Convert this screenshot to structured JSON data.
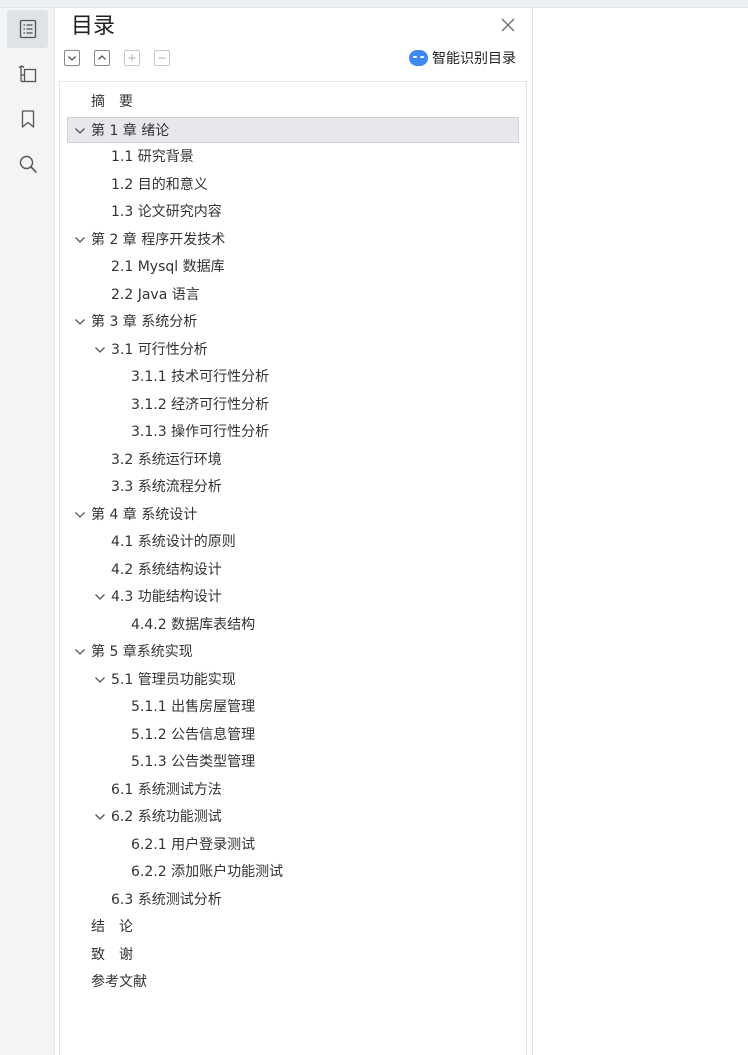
{
  "panel": {
    "title": "目录",
    "smart_label": "智能识别目录"
  },
  "icons": {
    "rail": [
      "toc-icon",
      "outline-tree-icon",
      "bookmark-icon",
      "search-icon"
    ],
    "toolbar": [
      "collapse-all-icon",
      "expand-all-icon",
      "add-icon",
      "remove-icon"
    ]
  },
  "colors": {
    "accent": "#3d8bf0",
    "selected_row": "#e6e8ec"
  },
  "toc": [
    {
      "text": "摘　要",
      "level": 0,
      "chevron": false
    },
    {
      "text": "第 1 章  绪论",
      "level": 0,
      "chevron": true,
      "selected": true
    },
    {
      "text": "1.1  研究背景",
      "level": 1,
      "chevron": false
    },
    {
      "text": "1.2 目的和意义",
      "level": 1,
      "chevron": false
    },
    {
      "text": "1.3  论文研究内容",
      "level": 1,
      "chevron": false
    },
    {
      "text": "第 2 章  程序开发技术",
      "level": 0,
      "chevron": true
    },
    {
      "text": "2.1 Mysql 数据库",
      "level": 1,
      "chevron": false
    },
    {
      "text": "2.2 Java 语言",
      "level": 1,
      "chevron": false
    },
    {
      "text": "第 3 章  系统分析",
      "level": 0,
      "chevron": true
    },
    {
      "text": "3.1 可行性分析",
      "level": 1,
      "chevron": true
    },
    {
      "text": "3.1.1 技术可行性分析",
      "level": 2,
      "chevron": false
    },
    {
      "text": "3.1.2 经济可行性分析",
      "level": 2,
      "chevron": false
    },
    {
      "text": "3.1.3 操作可行性分析",
      "level": 2,
      "chevron": false
    },
    {
      "text": "3.2 系统运行环境",
      "level": 1,
      "chevron": false
    },
    {
      "text": "3.3 系统流程分析",
      "level": 1,
      "chevron": false
    },
    {
      "text": "第 4 章  系统设计",
      "level": 0,
      "chevron": true
    },
    {
      "text": "4.1  系统设计的原则",
      "level": 1,
      "chevron": false
    },
    {
      "text": "4.2  系统结构设计",
      "level": 1,
      "chevron": false
    },
    {
      "text": "4.3 功能结构设计",
      "level": 1,
      "chevron": true
    },
    {
      "text": "4.4.2  数据库表结构",
      "level": 2,
      "chevron": false
    },
    {
      "text": "第 5 章系统实现",
      "level": 0,
      "chevron": true
    },
    {
      "text": "5.1 管理员功能实现",
      "level": 1,
      "chevron": true
    },
    {
      "text": "5.1.1  出售房屋管理",
      "level": 2,
      "chevron": false
    },
    {
      "text": "5.1.2  公告信息管理",
      "level": 2,
      "chevron": false
    },
    {
      "text": "5.1.3 公告类型管理",
      "level": 2,
      "chevron": false
    },
    {
      "text": "6.1 系统测试方法",
      "level": 1,
      "chevron": false
    },
    {
      "text": "6.2  系统功能测试",
      "level": 1,
      "chevron": true
    },
    {
      "text": "6.2.1  用户登录测试",
      "level": 2,
      "chevron": false
    },
    {
      "text": "6.2.2  添加账户功能测试",
      "level": 2,
      "chevron": false
    },
    {
      "text": "6.3  系统测试分析",
      "level": 1,
      "chevron": false
    },
    {
      "text": "结　论",
      "level": 0,
      "chevron": false
    },
    {
      "text": "致　谢",
      "level": 0,
      "chevron": false
    },
    {
      "text": "参考文献",
      "level": 0,
      "chevron": false
    }
  ]
}
